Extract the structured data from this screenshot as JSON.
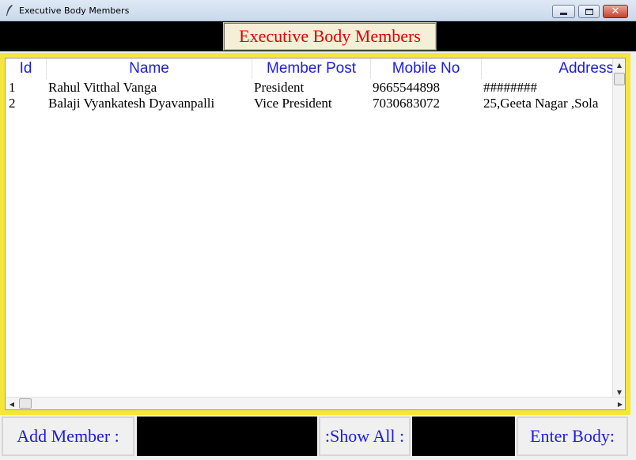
{
  "window": {
    "title": "Executive Body Members",
    "icon": "feather-icon"
  },
  "header": {
    "title": "Executive Body Members"
  },
  "table": {
    "columns": [
      {
        "key": "id",
        "label": "Id"
      },
      {
        "key": "name",
        "label": "Name"
      },
      {
        "key": "post",
        "label": "Member Post"
      },
      {
        "key": "mobile",
        "label": "Mobile No"
      },
      {
        "key": "address",
        "label": "Address"
      }
    ],
    "rows": [
      {
        "id": "1",
        "name": "Rahul Vitthal Vanga",
        "post": "President",
        "mobile": "9665544898",
        "address": "########"
      },
      {
        "id": "2",
        "name": "Balaji Vyankatesh Dyavanpalli",
        "post": "Vice President",
        "mobile": "7030683072",
        "address": "25,Geeta Nagar ,Sola"
      }
    ]
  },
  "controls": {
    "add_member_label": "Add Member :",
    "show_all_label": ":Show All :",
    "enter_body_label": "Enter Body:"
  },
  "colors": {
    "header_text": "#e00000",
    "column_text": "#1c1cdf",
    "frame": "#f5e63a"
  }
}
